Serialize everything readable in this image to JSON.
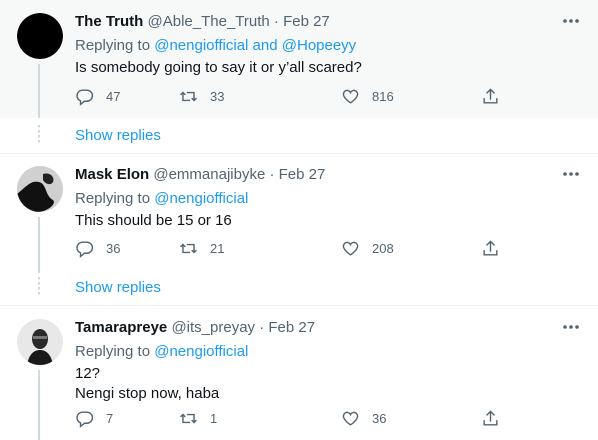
{
  "tweets": [
    {
      "name": "The Truth",
      "handle": "@Able_The_Truth",
      "date": "· Feb 27",
      "replying_prefix": "Replying to ",
      "replying_to": "@nengiofficial and @Hopeeyy",
      "text": "Is somebody going to say it or y’all scared?",
      "replies": "47",
      "retweets": "33",
      "likes": "816"
    },
    {
      "name": "Mask Elon",
      "handle": "@emmanajibyke",
      "date": "· Feb 27",
      "replying_prefix": "Replying to ",
      "replying_to": "@nengiofficial",
      "text": "This should be 15 or 16",
      "replies": "36",
      "retweets": "21",
      "likes": "208"
    },
    {
      "name": "Tamarapreye",
      "handle": "@its_preyay",
      "date": "· Feb 27",
      "replying_prefix": "Replying to ",
      "replying_to": "@nengiofficial",
      "text_line1": "12?",
      "text_line2": "Nengi stop now, haba",
      "replies": "7",
      "retweets": "1",
      "likes": "36"
    }
  ],
  "show_replies_label": "Show replies",
  "colors": {
    "accent": "#1d9bf0",
    "muted": "#536471",
    "text": "#0f1419"
  }
}
